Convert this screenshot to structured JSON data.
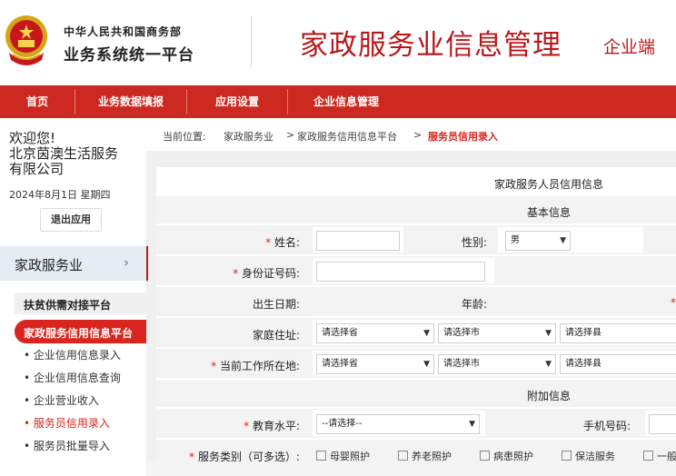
{
  "header": {
    "org_line1": "中华人民共和国商务部",
    "org_line2": "业务系统统一平台",
    "app_title": "家政服务业信息管理",
    "app_subtitle": "企业端"
  },
  "nav": {
    "items": [
      "首页",
      "业务数据填报",
      "应用设置",
      "企业信息管理"
    ]
  },
  "sidebar": {
    "welcome": "欢迎您!",
    "company_line1": "北京茵澳生活服务",
    "company_line2": "有限公司",
    "date": "2024年8月1日 星期四",
    "logout": "退出应用",
    "section": "家政服务业",
    "section_arrow": "›",
    "group": "扶贫供需对接平台",
    "active_group": "家政服务信用信息平台",
    "links": [
      "• 企业信用信息录入",
      "• 企业信用信息查询",
      "• 企业营业收入",
      "• 服务员信用录入",
      "• 服务员批量导入"
    ]
  },
  "breadcrumb": {
    "prefix": "当前位置:",
    "path1": "家政服务业",
    "sep": ">",
    "path2": "家政服务信用信息平台",
    "current": "服务员信用录入"
  },
  "form": {
    "title": "家政服务人员信用信息",
    "basic_section": "基本信息",
    "extra_section": "附加信息",
    "name_label": "姓名:",
    "gender_label": "性别:",
    "gender_value": "男",
    "id_label": "身份证号码:",
    "birth_label": "出生日期:",
    "age_label": "年龄:",
    "home_label": "家庭住址:",
    "work_label": "当前工作所在地:",
    "province_placeholder": "请选择省",
    "city_placeholder": "请选择市",
    "county_placeholder": "请选择县",
    "edu_label": "教育水平:",
    "edu_placeholder": "--请选择--",
    "phone_label": "手机号码:",
    "service_label": "服务类别（可多选）:",
    "service_options": [
      "母婴照护",
      "养老照护",
      "病患照护",
      "保洁服务",
      "一般"
    ]
  }
}
